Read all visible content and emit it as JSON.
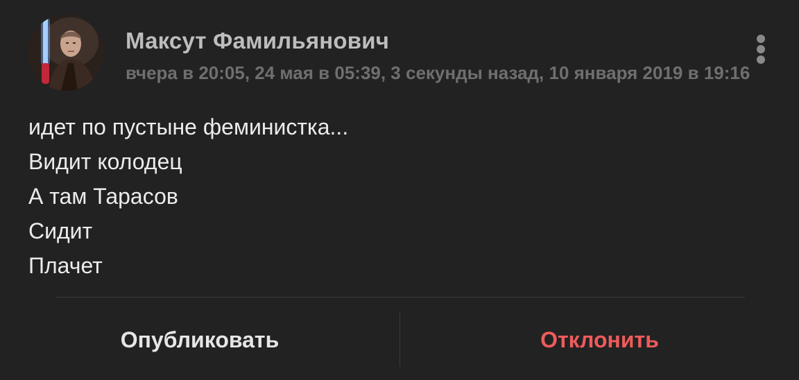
{
  "author": {
    "name": "Максут Фамильянович",
    "avatar": "avatar-photo"
  },
  "timestamp": "вчера в 20:05, 24 мая в 05:39, 3 секунды назад, 10 января 2019 в 19:16",
  "menu_icon": "more-vertical-icon",
  "post": {
    "lines": [
      "идет по пустыне феминистка...",
      "Видит колодец",
      "А там Тарасов",
      "Сидит",
      "Плачет"
    ]
  },
  "actions": {
    "publish_label": "Опубликовать",
    "reject_label": "Отклонить"
  },
  "colors": {
    "background": "#222222",
    "reject": "#ee5b5b",
    "name": "#bdbdbd",
    "timestamp": "#6f6f6f"
  }
}
